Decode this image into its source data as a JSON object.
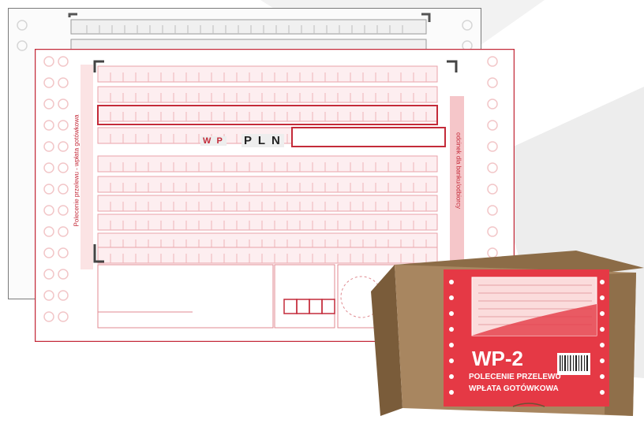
{
  "form": {
    "wp_code": "W P",
    "currency": "P L N",
    "vertical_left": "Polecenie przelewu - wpłata gotówkowa",
    "vertical_right": "odcinek dla banku/odbiorcy"
  },
  "box": {
    "title": "WP-2",
    "line1": "POLECENIE PRZELEWU",
    "line2": "WPŁATA GOTÓWKOWA"
  },
  "colors": {
    "form_red": "#d8343f",
    "form_pink": "#f4c9cb",
    "box_brown": "#a07e58",
    "label_red": "#e53945"
  }
}
